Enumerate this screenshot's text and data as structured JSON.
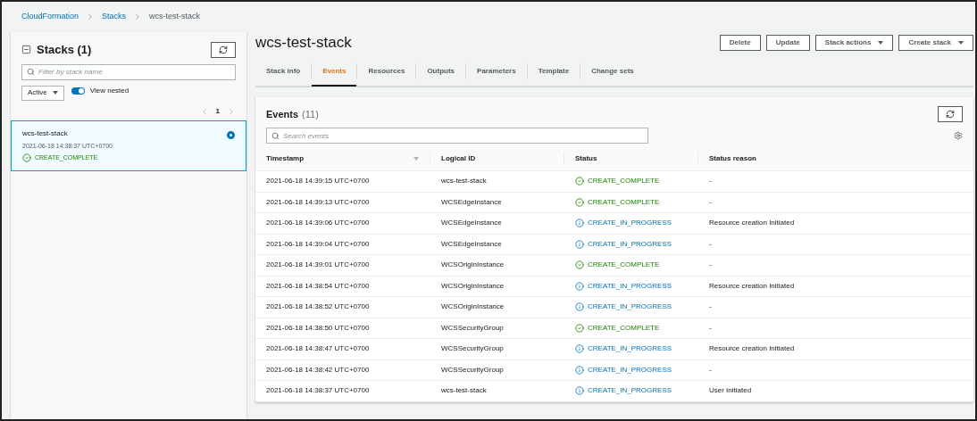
{
  "breadcrumb": [
    {
      "label": "CloudFormation",
      "link": true
    },
    {
      "label": "Stacks",
      "link": true
    },
    {
      "label": "wcs-test-stack",
      "link": false
    }
  ],
  "sidebar": {
    "title": "Stacks (1)",
    "filter": {
      "placeholder": "Filter by stack name"
    },
    "status_filter": "Active",
    "view_nested": {
      "label": "View nested",
      "on": true
    },
    "page": "1",
    "stacks": [
      {
        "name": "wcs-test-stack",
        "time": "2021-06-18 14:38:37 UTC+0700",
        "status": "CREATE_COMPLETE",
        "selected": true
      }
    ]
  },
  "title": "wcs-test-stack",
  "actions": [
    {
      "label": "Delete",
      "dropdown": false
    },
    {
      "label": "Update",
      "dropdown": false
    },
    {
      "label": "Stack actions",
      "dropdown": true
    },
    {
      "label": "Create stack",
      "dropdown": true
    }
  ],
  "tabs": [
    {
      "label": "Stack info",
      "selected": false
    },
    {
      "label": "Events",
      "selected": true
    },
    {
      "label": "Resources",
      "selected": false
    },
    {
      "label": "Outputs",
      "selected": false
    },
    {
      "label": "Parameters",
      "selected": false
    },
    {
      "label": "Template",
      "selected": false
    },
    {
      "label": "Change sets",
      "selected": false
    }
  ],
  "events": {
    "title": "Events",
    "count": "(11)",
    "search": {
      "placeholder": "Search events"
    },
    "columns": [
      "Timestamp",
      "Logical ID",
      "Status",
      "Status reason"
    ],
    "rows": [
      {
        "timestamp": "2021-06-18 14:39:15 UTC+0700",
        "logical_id": "wcs-test-stack",
        "status": "CREATE_COMPLETE",
        "kind": "complete",
        "reason": "-"
      },
      {
        "timestamp": "2021-06-18 14:39:13 UTC+0700",
        "logical_id": "WCSEdgeInstance",
        "status": "CREATE_COMPLETE",
        "kind": "complete",
        "reason": "-"
      },
      {
        "timestamp": "2021-06-18 14:39:06 UTC+0700",
        "logical_id": "WCSEdgeInstance",
        "status": "CREATE_IN_PROGRESS",
        "kind": "in_progress",
        "reason": "Resource creation Initiated"
      },
      {
        "timestamp": "2021-06-18 14:39:04 UTC+0700",
        "logical_id": "WCSEdgeInstance",
        "status": "CREATE_IN_PROGRESS",
        "kind": "in_progress",
        "reason": "-"
      },
      {
        "timestamp": "2021-06-18 14:39:01 UTC+0700",
        "logical_id": "WCSOriginInstance",
        "status": "CREATE_COMPLETE",
        "kind": "complete",
        "reason": "-"
      },
      {
        "timestamp": "2021-06-18 14:38:54 UTC+0700",
        "logical_id": "WCSOriginInstance",
        "status": "CREATE_IN_PROGRESS",
        "kind": "in_progress",
        "reason": "Resource creation Initiated"
      },
      {
        "timestamp": "2021-06-18 14:38:52 UTC+0700",
        "logical_id": "WCSOriginInstance",
        "status": "CREATE_IN_PROGRESS",
        "kind": "in_progress",
        "reason": "-"
      },
      {
        "timestamp": "2021-06-18 14:38:50 UTC+0700",
        "logical_id": "WCSSecurityGroup",
        "status": "CREATE_COMPLETE",
        "kind": "complete",
        "reason": "-"
      },
      {
        "timestamp": "2021-06-18 14:38:47 UTC+0700",
        "logical_id": "WCSSecurityGroup",
        "status": "CREATE_IN_PROGRESS",
        "kind": "in_progress",
        "reason": "Resource creation Initiated"
      },
      {
        "timestamp": "2021-06-18 14:38:42 UTC+0700",
        "logical_id": "WCSSecurityGroup",
        "status": "CREATE_IN_PROGRESS",
        "kind": "in_progress",
        "reason": "-"
      },
      {
        "timestamp": "2021-06-18 14:38:37 UTC+0700",
        "logical_id": "wcs-test-stack",
        "status": "CREATE_IN_PROGRESS",
        "kind": "in_progress",
        "reason": "User Initiated"
      }
    ]
  }
}
